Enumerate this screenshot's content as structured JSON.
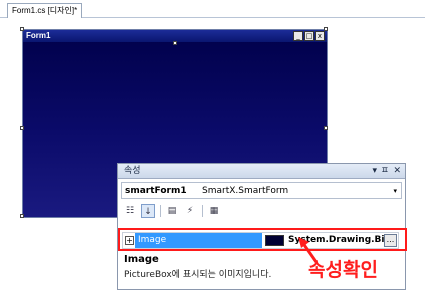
{
  "tab": {
    "label": "Form1.cs [디자인]*"
  },
  "form": {
    "title": "Form1",
    "buttons": {
      "minimize": "_",
      "maximize": "□",
      "close": "x"
    }
  },
  "properties": {
    "title": "속성",
    "title_buttons": {
      "dropdown": "▾",
      "pin": "ㅍ",
      "close": "✕"
    },
    "object_name": "smartForm1",
    "object_type": "SmartX.SmartForm",
    "object_arrow": "▾",
    "toolbar": {
      "categorized": "☷",
      "alphabetical": "↓",
      "properties": "▤",
      "events": "⚡",
      "pages": "▦"
    },
    "row": {
      "expander": "+",
      "name": "Image",
      "value": "System.Drawing.Bitr",
      "ellipsis": "..."
    },
    "description": {
      "title": "Image",
      "text": "PictureBox에 표시되는 이미지입니다."
    }
  },
  "annotation": {
    "text": "속성확인",
    "color": "#ff1e1e"
  },
  "colors": {
    "selection": "#3399ff",
    "form_background": "#00004a"
  }
}
